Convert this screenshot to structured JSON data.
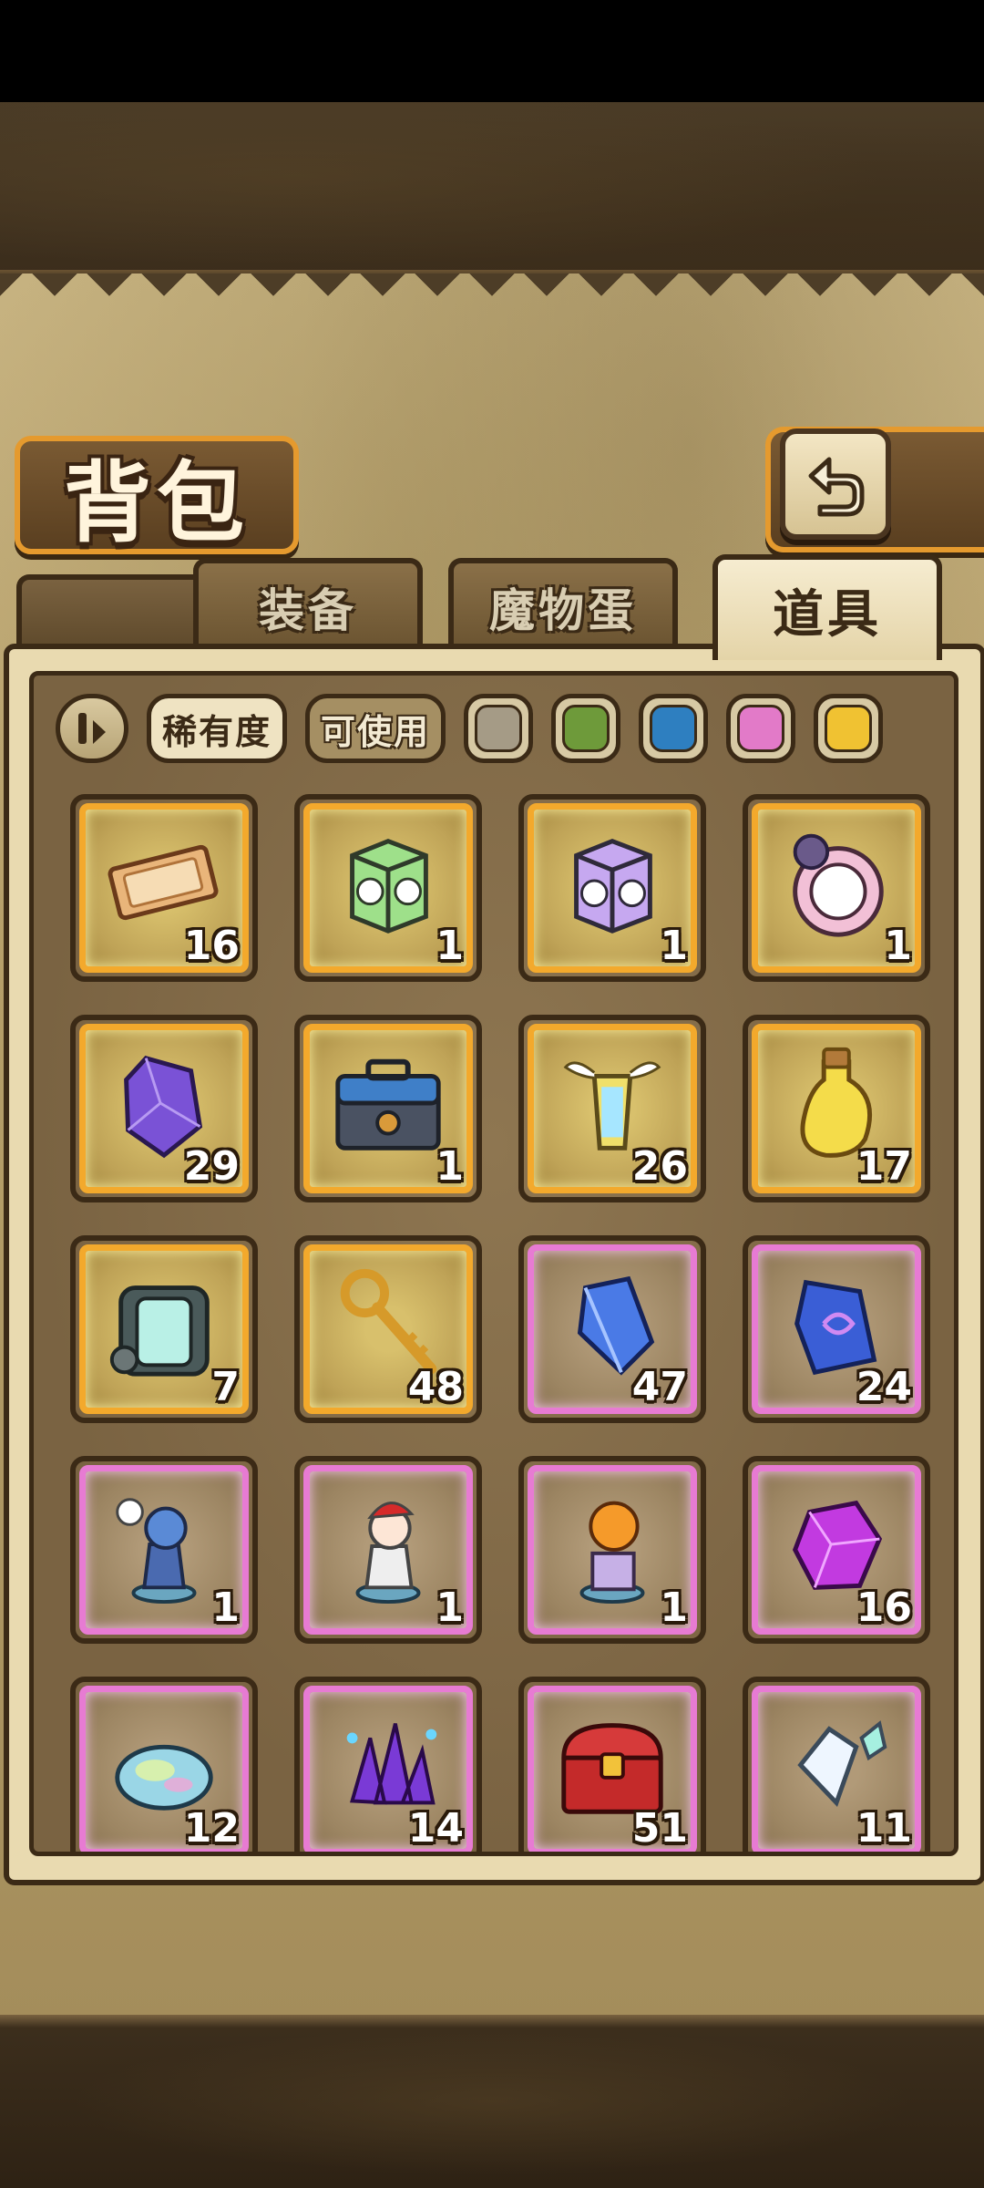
{
  "header": {
    "title": "背包",
    "back_icon": "back-arrow-icon"
  },
  "tabs": [
    {
      "label": "装备",
      "active": false
    },
    {
      "label": "魔物蛋",
      "active": false
    },
    {
      "label": "道具",
      "active": true
    }
  ],
  "filters": {
    "sort_icon": "sort-toggle-icon",
    "rarity_label": "稀有度",
    "usable_label": "可使用",
    "colors": [
      {
        "name": "gray",
        "hex": "#a59b86"
      },
      {
        "name": "green",
        "hex": "#6e9a3a"
      },
      {
        "name": "blue",
        "hex": "#2e7fc0"
      },
      {
        "name": "pink",
        "hex": "#e27ac8"
      },
      {
        "name": "yellow",
        "hex": "#f0c232"
      }
    ]
  },
  "rarity_colors": {
    "gold": "#f3a92c",
    "pink": "#e77bd3"
  },
  "items": [
    {
      "icon": "ticket-icon",
      "qty": "16",
      "rarity": "gold"
    },
    {
      "icon": "green-ghost-box-icon",
      "qty": "1",
      "rarity": "gold"
    },
    {
      "icon": "purple-ghost-box-icon",
      "qty": "1",
      "rarity": "gold"
    },
    {
      "icon": "pocket-watch-icon",
      "qty": "1",
      "rarity": "gold"
    },
    {
      "icon": "purple-crystal-icon",
      "qty": "29",
      "rarity": "gold"
    },
    {
      "icon": "toolbox-icon",
      "qty": "1",
      "rarity": "gold"
    },
    {
      "icon": "winged-lantern-icon",
      "qty": "26",
      "rarity": "gold"
    },
    {
      "icon": "potion-bottle-icon",
      "qty": "17",
      "rarity": "gold"
    },
    {
      "icon": "portal-gate-icon",
      "qty": "7",
      "rarity": "gold"
    },
    {
      "icon": "golden-key-icon",
      "qty": "48",
      "rarity": "gold"
    },
    {
      "icon": "blue-crystal-icon",
      "qty": "47",
      "rarity": "pink"
    },
    {
      "icon": "blue-rune-crystal-icon",
      "qty": "24",
      "rarity": "pink"
    },
    {
      "icon": "blue-figure-icon",
      "qty": "1",
      "rarity": "pink"
    },
    {
      "icon": "santa-figure-icon",
      "qty": "1",
      "rarity": "pink"
    },
    {
      "icon": "pumpkin-figure-icon",
      "qty": "1",
      "rarity": "pink"
    },
    {
      "icon": "pink-gem-icon",
      "qty": "16",
      "rarity": "pink"
    },
    {
      "icon": "opal-stone-icon",
      "qty": "12",
      "rarity": "pink"
    },
    {
      "icon": "amethyst-cluster-icon",
      "qty": "14",
      "rarity": "pink"
    },
    {
      "icon": "treasure-chest-icon",
      "qty": "51",
      "rarity": "pink"
    },
    {
      "icon": "prism-shard-icon",
      "qty": "11",
      "rarity": "pink"
    }
  ]
}
